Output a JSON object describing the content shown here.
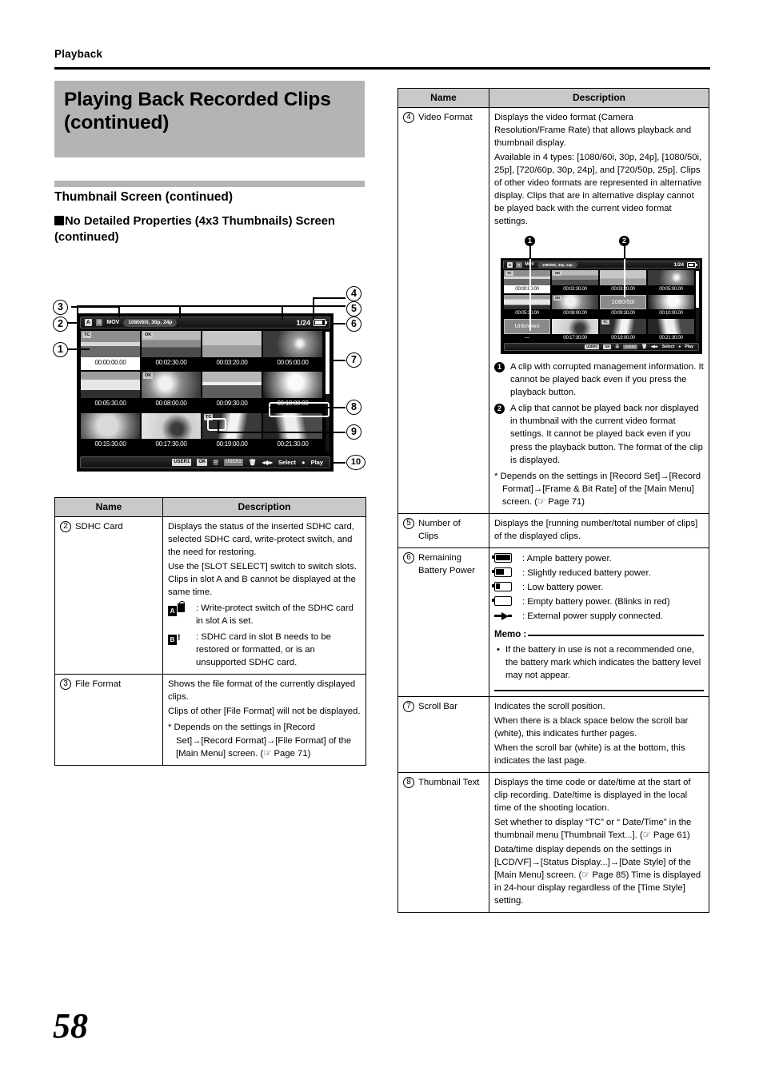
{
  "running_head": "Playback",
  "chapter_title": "Playing Back Recorded Clips (continued)",
  "section_heading": "Thumbnail Screen (continued)",
  "subsection_heading": "No Detailed Properties (4x3 Thumbnails) Screen (continued)",
  "page_number": "58",
  "diagram": {
    "callouts": [
      "1",
      "2",
      "3",
      "4",
      "5",
      "6",
      "7",
      "8",
      "9",
      "10"
    ],
    "status_bar": {
      "slot_a": "A",
      "slot_b": "B",
      "file_format": "MOV",
      "video_format": "1080/60i, 30p, 24p",
      "clip_count": "1/24"
    },
    "bottom_bar": {
      "user1": "USER1",
      "user1_icon": "OK",
      "user2": "USER2",
      "user2_icon": "trash-icon",
      "select": "Select",
      "play": "Play"
    },
    "thumbnails": [
      {
        "label": "00:00:00.00",
        "badge": "TC",
        "selected": true
      },
      {
        "label": "00:02:30.00",
        "badge": "OK",
        "selected": false
      },
      {
        "label": "00:03:20.00",
        "badge": "",
        "selected": false
      },
      {
        "label": "00:05:00.00",
        "badge": "",
        "selected": false
      },
      {
        "label": "00:05:30.00",
        "badge": "",
        "selected": false
      },
      {
        "label": "00:08:00.00",
        "badge": "OK",
        "selected": false
      },
      {
        "label": "00:09:30.00",
        "badge": "",
        "selected": false
      },
      {
        "label": "00:10:00.00",
        "badge": "",
        "selected": false
      },
      {
        "label": "00:15:30.00",
        "badge": "",
        "selected": false
      },
      {
        "label": "00:17:30.00",
        "badge": "",
        "selected": false
      },
      {
        "label": "00:19:00.00",
        "badge": "TC",
        "selected": false
      },
      {
        "label": "00:21:30.00",
        "badge": "",
        "selected": false
      }
    ]
  },
  "table_left": {
    "header_name": "Name",
    "header_description": "Description",
    "rows": [
      {
        "num": "2",
        "name": "SDHC Card",
        "paras": [
          "Displays the status of the inserted SDHC card, selected SDHC card, write-protect switch, and the need for restoring.",
          "Use the [SLOT SELECT] switch to switch slots. Clips in slot A and B cannot be displayed at the same time."
        ],
        "icon_defs": [
          {
            "icon": "card-a-locked-icon",
            "text": ": Write-protect switch of the SDHC card in slot A is set."
          },
          {
            "icon": "card-b-alert-icon",
            "text": ": SDHC card in slot B needs to be restored or formatted, or is an unsupported SDHC card."
          }
        ]
      },
      {
        "num": "3",
        "name": "File Format",
        "paras": [
          "Shows the file format of the currently displayed clips.",
          "Clips of other [File Format] will not be displayed."
        ],
        "footnote": "* Depends on the settings in [Record Set]→[Record Format]→[File Format] of the [Main Menu] screen. (☞ Page 71)"
      }
    ]
  },
  "table_right": {
    "header_name": "Name",
    "header_description": "Description",
    "rows": [
      {
        "num": "4",
        "name": "Video Format",
        "paras": [
          "Displays the video format (Camera Resolution/Frame Rate) that allows playback and thumbnail display.",
          "Available in 4 types: [1080/60i, 30p, 24p], [1080/50i, 25p], [720/60p, 30p, 24p], and [720/50p, 25p]. Clips of other video formats are represented in alternative display. Clips that are in alternative display cannot be played back with the current video format settings."
        ],
        "inset": {
          "markers": [
            "1",
            "2"
          ],
          "status_bar": {
            "slot_a": "A",
            "slot_b": "B",
            "file_format": "MOV",
            "video_format": "1080/60i, 30p, 24p",
            "clip_count": "1/24"
          },
          "bottom_bar": {
            "user1": "USER1",
            "user1_icon": "OK",
            "user2": "USER2",
            "user2_icon": "trash-icon",
            "select": "Select",
            "play": "Play"
          },
          "thumbnails": [
            {
              "label": "00:00:00.00",
              "badge": "TC",
              "selected": true,
              "alt": ""
            },
            {
              "label": "00:02:30.00",
              "badge": "OK",
              "selected": false,
              "alt": ""
            },
            {
              "label": "00:03:20.00",
              "badge": "",
              "selected": false,
              "alt": ""
            },
            {
              "label": "00:05:00.00",
              "badge": "",
              "selected": false,
              "alt": ""
            },
            {
              "label": "00:05:30.00",
              "badge": "",
              "selected": false,
              "alt": ""
            },
            {
              "label": "00:08:00.00",
              "badge": "OK",
              "selected": false,
              "alt": ""
            },
            {
              "label": "00:09:30.00",
              "badge": "",
              "selected": false,
              "alt": "1080/50i"
            },
            {
              "label": "00:10:00.00",
              "badge": "",
              "selected": false,
              "alt": ""
            },
            {
              "label": "",
              "badge": "",
              "selected": false,
              "alt": "Unknown"
            },
            {
              "label": "00:17:30.00",
              "badge": "",
              "selected": false,
              "alt": ""
            },
            {
              "label": "00:19:00.00",
              "badge": "TC",
              "selected": false,
              "alt": ""
            },
            {
              "label": "00:21:30.00",
              "badge": "",
              "selected": false,
              "alt": ""
            }
          ]
        },
        "notes": [
          {
            "num": "1",
            "text": "A clip with corrupted management information. It cannot be played back even if you press the playback button."
          },
          {
            "num": "2",
            "text": "A clip that cannot be played back nor displayed in thumbnail with the current video format settings. It cannot be played back even if you press the playback button. The format of the clip is displayed."
          }
        ],
        "footnote": "* Depends on the settings in [Record Set]→[Record Format]→[Frame & Bit Rate] of the [Main Menu] screen. (☞ Page 71)"
      },
      {
        "num": "5",
        "name": "Number of Clips",
        "paras": [
          "Displays the [running number/total number of clips] of the displayed clips."
        ]
      },
      {
        "num": "6",
        "name": "Remaining Battery Power",
        "battery_defs": [
          {
            "icon": "battery-full-icon",
            "text": ": Ample battery power."
          },
          {
            "icon": "battery-two-thirds-icon",
            "text": ": Slightly reduced battery power."
          },
          {
            "icon": "battery-low-icon",
            "text": ": Low battery power."
          },
          {
            "icon": "battery-empty-icon",
            "text": ": Empty battery power. (Blinks in red)"
          },
          {
            "icon": "power-plug-icon",
            "text": ": External power supply connected."
          }
        ],
        "memo_label": "Memo :",
        "memo_items": [
          "If the battery in use is not a recommended one, the battery mark which indicates the battery level may not appear."
        ]
      },
      {
        "num": "7",
        "name": "Scroll Bar",
        "paras": [
          "Indicates the scroll position.",
          "When there is a black space below the scroll bar (white), this indicates further pages.",
          "When the scroll bar (white) is at the bottom, this indicates the last page."
        ]
      },
      {
        "num": "8",
        "name": "Thumbnail Text",
        "paras": [
          "Displays the time code or date/time at the start of clip recording. Date/time is displayed in the local time of the shooting location.",
          "Set whether to display “TC” or “ Date/Time” in the thumbnail menu [Thumbnail Text...]. (☞ Page 61)",
          "Data/time display depends on the settings in [LCD/VF]→[Status Display...]→[Date Style] of the [Main Menu] screen. (☞ Page 85) Time is displayed in 24-hour display regardless of the [Time Style] setting."
        ]
      }
    ]
  }
}
